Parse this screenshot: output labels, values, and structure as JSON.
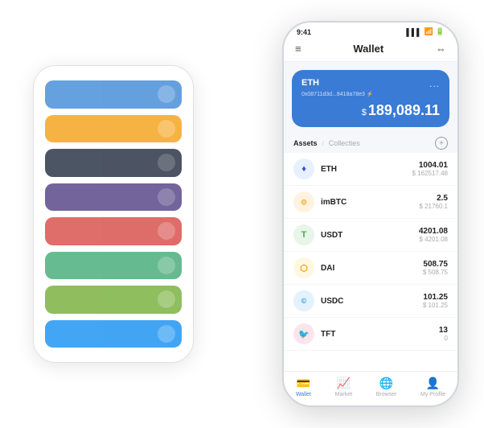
{
  "bgCards": [
    {
      "color": "card-blue",
      "dotColor": "rgba(255,255,255,0.5)"
    },
    {
      "color": "card-yellow",
      "dotColor": "rgba(255,255,255,0.5)"
    },
    {
      "color": "card-dark",
      "dotColor": "rgba(255,255,255,0.5)"
    },
    {
      "color": "card-purple",
      "dotColor": "rgba(255,255,255,0.5)"
    },
    {
      "color": "card-red",
      "dotColor": "rgba(255,255,255,0.5)"
    },
    {
      "color": "card-green1",
      "dotColor": "rgba(255,255,255,0.5)"
    },
    {
      "color": "card-green2",
      "dotColor": "rgba(255,255,255,0.5)"
    },
    {
      "color": "card-blue2",
      "dotColor": "rgba(255,255,255,0.5)"
    }
  ],
  "statusBar": {
    "time": "9:41",
    "batteryIcon": "▌"
  },
  "header": {
    "title": "Wallet",
    "hamburgerIcon": "≡",
    "scanIcon": "⇔"
  },
  "ethCard": {
    "label": "ETH",
    "address": "0x08711d3d...8418a78e3  ⚡",
    "dotsLabel": "...",
    "balanceSymbol": "$",
    "balance": "189,089.11"
  },
  "assetsSection": {
    "activeTab": "Assets",
    "divider": "/",
    "inactiveTab": "Collecties",
    "addIcon": "+"
  },
  "assets": [
    {
      "symbol": "ETH",
      "iconLabel": "♦",
      "iconClass": "asset-icon-eth",
      "amount": "1004.01",
      "usd": "$ 162517.48"
    },
    {
      "symbol": "imBTC",
      "iconLabel": "⊙",
      "iconClass": "asset-icon-imbtc",
      "amount": "2.5",
      "usd": "$ 21760.1"
    },
    {
      "symbol": "USDT",
      "iconLabel": "T",
      "iconClass": "asset-icon-usdt",
      "amount": "4201.08",
      "usd": "$ 4201.08"
    },
    {
      "symbol": "DAI",
      "iconLabel": "⬡",
      "iconClass": "asset-icon-dai",
      "amount": "508.75",
      "usd": "$ 508.75"
    },
    {
      "symbol": "USDC",
      "iconLabel": "©",
      "iconClass": "asset-icon-usdc",
      "amount": "101.25",
      "usd": "$ 101.25"
    },
    {
      "symbol": "TFT",
      "iconLabel": "🐦",
      "iconClass": "asset-icon-tft",
      "amount": "13",
      "usd": "0"
    }
  ],
  "bottomNav": [
    {
      "label": "Wallet",
      "icon": "💳",
      "active": true
    },
    {
      "label": "Market",
      "icon": "📊",
      "active": false
    },
    {
      "label": "Browser",
      "icon": "👤",
      "active": false
    },
    {
      "label": "My Profile",
      "icon": "👤",
      "active": false
    }
  ]
}
